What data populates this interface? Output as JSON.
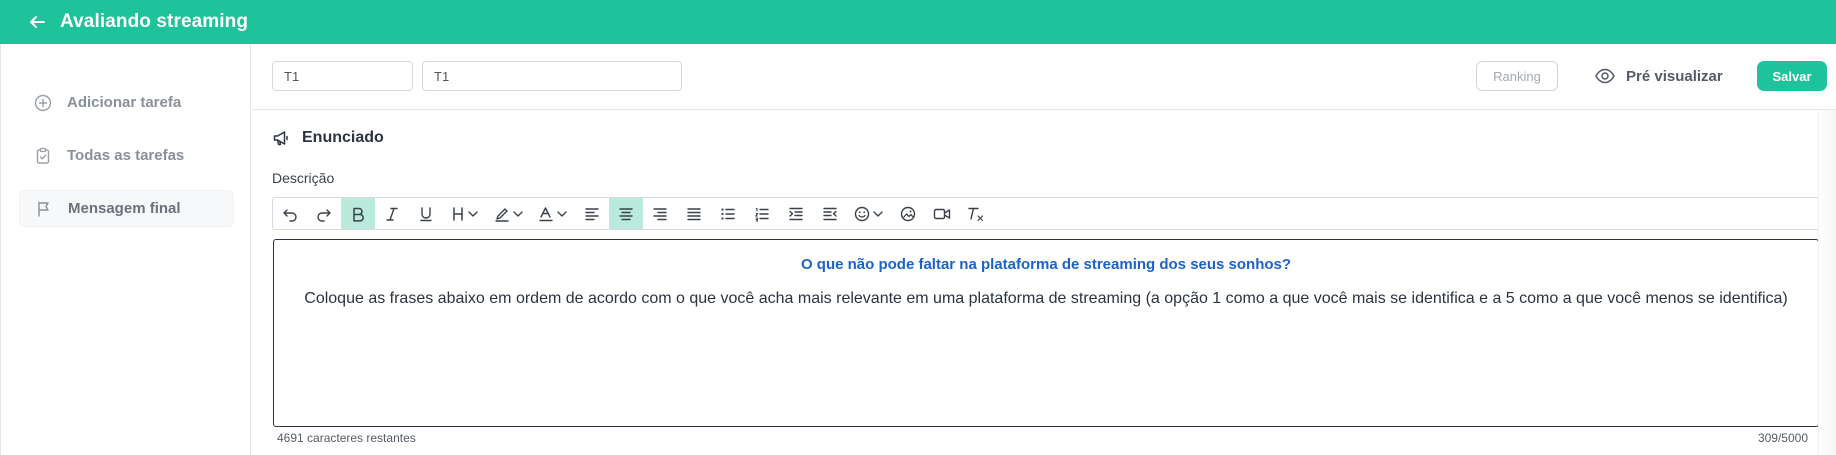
{
  "app": {
    "title": "Avaliando streaming"
  },
  "sidebar": {
    "items": [
      {
        "label": "Adicionar tarefa",
        "icon": "plus-circle-icon"
      },
      {
        "label": "Todas as tarefas",
        "icon": "clipboard-check-icon"
      },
      {
        "label": "Mensagem final",
        "icon": "flag-icon"
      }
    ]
  },
  "header": {
    "input1_value": "T1",
    "input2_value": "T1",
    "ranking_label": "Ranking",
    "preview_label": "Pré visualizar",
    "save_label": "Salvar"
  },
  "section": {
    "title": "Enunciado",
    "description_label": "Descrição"
  },
  "toolbar": {
    "buttons": [
      "undo-icon",
      "redo-icon",
      "bold-icon",
      "italic-icon",
      "underline-icon",
      "heading-icon",
      "highlight-icon",
      "font-color-icon",
      "align-left-icon",
      "align-center-icon",
      "align-right-icon",
      "align-justify-icon",
      "bullet-list-icon",
      "numbered-list-icon",
      "indent-icon",
      "outdent-icon",
      "emoji-icon",
      "image-icon",
      "video-icon",
      "clear-format-icon"
    ],
    "active": [
      "bold-icon",
      "align-center-icon"
    ]
  },
  "editor": {
    "headline": "O que não pode faltar na plataforma de streaming dos seus sonhos?",
    "body": "Coloque as frases abaixo em ordem de acordo com o que você acha mais relevante em uma plataforma de streaming (a opção 1 como a que você mais se identifica e a 5 como a que você menos se identifica)"
  },
  "footer": {
    "remaining": "4691 caracteres restantes",
    "count": "309/5000"
  },
  "colors": {
    "accent": "#1ec29b",
    "headline": "#1b63c7",
    "active_tool": "#b9eadb"
  }
}
